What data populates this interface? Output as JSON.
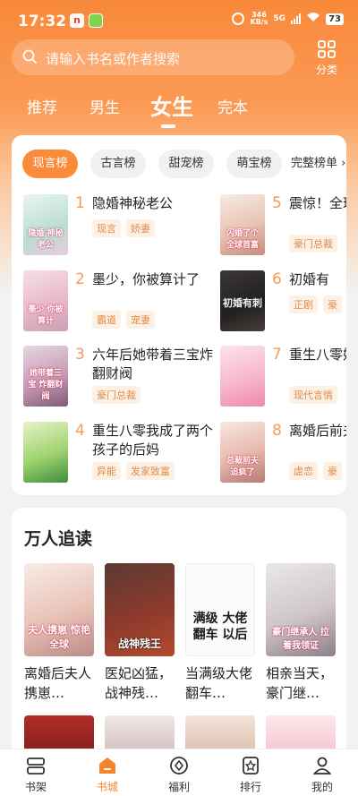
{
  "status": {
    "time": "17:32",
    "app_icon_text": "n",
    "speed_top": "346",
    "speed_bottom": "KB/s",
    "net": "5G",
    "battery": "73"
  },
  "search": {
    "placeholder": "请输入书名或作者搜索"
  },
  "category": {
    "label": "分类"
  },
  "tabs": [
    {
      "label": "推荐"
    },
    {
      "label": "男生"
    },
    {
      "label": "女生"
    },
    {
      "label": "完本"
    }
  ],
  "active_tab": "女生",
  "ranking": {
    "chips": [
      {
        "label": "现言榜"
      },
      {
        "label": "古言榜"
      },
      {
        "label": "甜宠榜"
      },
      {
        "label": "萌宝榜"
      }
    ],
    "more_label": "完整榜单",
    "books": [
      {
        "rank": "1",
        "title": "隐婚神秘老公",
        "tags": [
          "现言",
          "娇妻"
        ],
        "cover_text": "隐婚 神秘老公"
      },
      {
        "rank": "2",
        "title": "墨少，你被算计了",
        "tags": [
          "霸道",
          "宠妻"
        ],
        "cover_text": "墨少 你被算计"
      },
      {
        "rank": "3",
        "title": "六年后她带着三宝炸翻财阀",
        "tags": [
          "豪门总裁"
        ],
        "cover_text": "她带着三宝 炸翻财阀"
      },
      {
        "rank": "4",
        "title": "重生八零我成了两个孩子的后妈",
        "tags": [
          "异能",
          "发家致富"
        ],
        "cover_text": ""
      },
      {
        "rank": "5",
        "title": "震惊！全球首",
        "tags": [
          "豪门总裁"
        ],
        "cover_text": "闪婚了个 全球首富"
      },
      {
        "rank": "6",
        "title": "初婚有",
        "tags": [
          "正剧",
          "豪"
        ],
        "cover_text": "初婚有刺"
      },
      {
        "rank": "7",
        "title": "重生八零婚",
        "tags": [
          "现代言情"
        ],
        "cover_text": ""
      },
      {
        "rank": "8",
        "title": "离婚后前夫",
        "tags": [
          "虐恋",
          "豪"
        ],
        "cover_text": "总裁前夫 追疯了"
      }
    ]
  },
  "popular": {
    "title": "万人追读",
    "books": [
      {
        "title": "离婚后夫人携崽…",
        "cover_text": "夫人携崽 惊艳全球"
      },
      {
        "title": "医妃凶猛，战神残…",
        "cover_text": "战神残王"
      },
      {
        "title": "当满级大佬翻车…",
        "cover_text": "满级 大佬 翻车 以后"
      },
      {
        "title": "相亲当天，豪门继…",
        "cover_text": "豪门继承人 拉着我领证"
      }
    ]
  },
  "bottom_nav": [
    {
      "label": "书架"
    },
    {
      "label": "书城"
    },
    {
      "label": "福利"
    },
    {
      "label": "排行"
    },
    {
      "label": "我的"
    }
  ],
  "accent_color": "#f5842a"
}
